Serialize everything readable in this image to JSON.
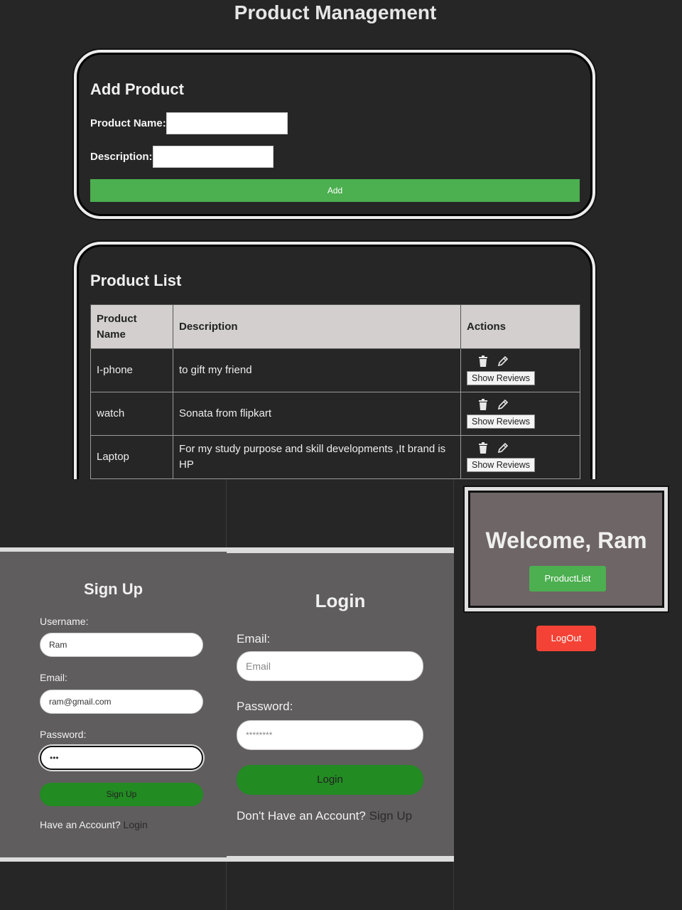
{
  "header": {
    "title": "Product Management"
  },
  "add_product": {
    "heading": "Add Product",
    "name_label": "Product Name:",
    "name_value": "",
    "description_label": "Description:",
    "description_value": "",
    "add_button": "Add"
  },
  "product_list": {
    "heading": "Product List",
    "columns": [
      "Product Name",
      "Description",
      "Actions"
    ],
    "rows": [
      {
        "name": "I-phone",
        "description": "to gift my friend",
        "reviews_button": "Show Reviews"
      },
      {
        "name": "watch",
        "description": "Sonata from flipkart",
        "reviews_button": "Show Reviews"
      },
      {
        "name": "Laptop",
        "description": "For my study purpose and skill developments ,It brand is HP",
        "reviews_button": "Show Reviews"
      }
    ],
    "icons": {
      "delete": "trash-icon",
      "edit": "pencil-icon"
    }
  },
  "signup": {
    "heading": "Sign Up",
    "username_label": "Username:",
    "username_value": "Ram",
    "email_label": "Email:",
    "email_value": "ram@gmail.com",
    "password_label": "Password:",
    "password_value": "•••",
    "submit_button": "Sign Up",
    "footer_text": "Have an Account?",
    "footer_link": "Login"
  },
  "login": {
    "heading": "Login",
    "email_label": "Email:",
    "email_placeholder": "Email",
    "password_label": "Password:",
    "password_value": "********",
    "submit_button": "Login",
    "footer_text": "Don't Have an Account?",
    "footer_link": "Sign Up"
  },
  "welcome": {
    "title": "Welcome, Ram",
    "productlist_button": "ProductList",
    "logout_button": "LogOut"
  },
  "colors": {
    "background": "#262626",
    "green": "#4caf50",
    "dark_green": "#228b22",
    "red": "#f44336",
    "card_gray": "#5f5d5e"
  }
}
